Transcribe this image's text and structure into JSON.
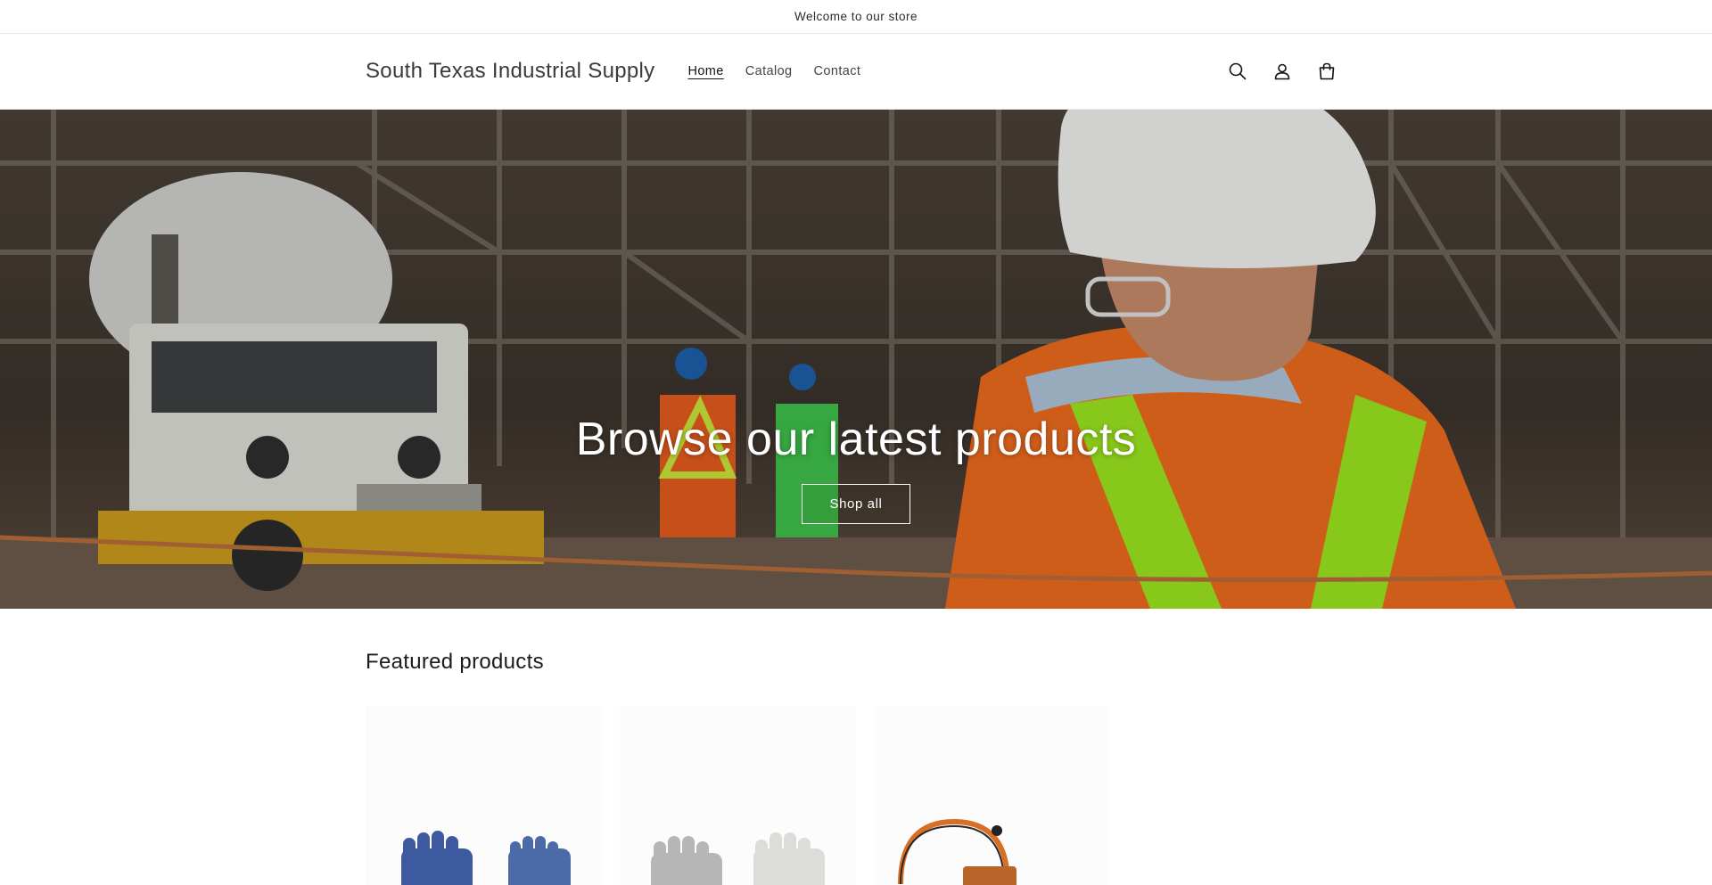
{
  "announcement": {
    "text": "Welcome to our store"
  },
  "header": {
    "site_title": "South Texas Industrial Supply",
    "nav": [
      {
        "label": "Home",
        "active": true
      },
      {
        "label": "Catalog",
        "active": false
      },
      {
        "label": "Contact",
        "active": false
      }
    ],
    "icons": [
      "search-icon",
      "account-icon",
      "cart-icon"
    ]
  },
  "hero": {
    "title": "Browse our latest products",
    "button_label": "Shop all"
  },
  "featured": {
    "title": "Featured products",
    "products": [
      {
        "image": "blue-coated-work-gloves"
      },
      {
        "image": "gray-white-cut-resistant-gloves"
      },
      {
        "image": "orange-tool-lanyard"
      }
    ]
  },
  "colors": {
    "accent_orange": "#e8621f",
    "hi_vis_green": "#9be41e",
    "text_dark": "#121212"
  }
}
